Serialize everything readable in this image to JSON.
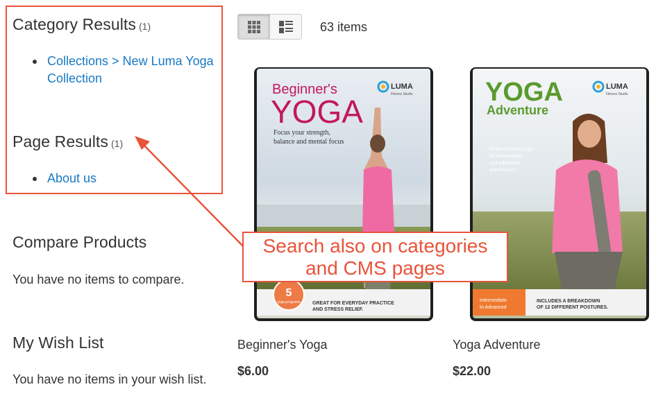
{
  "sidebar": {
    "category_results": {
      "title": "Category Results",
      "count": "(1)",
      "links": [
        "Collections > New Luma Yoga Collection"
      ]
    },
    "page_results": {
      "title": "Page Results",
      "count": "(1)",
      "links": [
        "About us"
      ]
    },
    "compare": {
      "title": "Compare Products",
      "empty_text": "You have no items to compare."
    },
    "wishlist": {
      "title": "My Wish List",
      "empty_text": "You have no items in your wish list."
    }
  },
  "toolbar": {
    "item_count": "63 items",
    "modes": [
      "grid-icon",
      "list-icon"
    ],
    "active_mode": "grid"
  },
  "products": [
    {
      "name": "Beginner's Yoga",
      "price": "$6.00",
      "cover": {
        "brand": "LUMA",
        "brand_sub": "Fitness Studio",
        "title_small": "Beginner's",
        "title_big": "YOGA",
        "subtitle": "Focus your strength, balance and mental focus",
        "badge_number": "5",
        "badge_text": "yoga programs",
        "footer_text": "GREAT FOR EVERYDAY PRACTICE AND STRESS RELIEF."
      }
    },
    {
      "name": "Yoga Adventure",
      "price": "$22.00",
      "cover": {
        "brand": "LUMA",
        "brand_sub": "Fitness Studio",
        "title_big": "YOGA",
        "title_small": "Adventure",
        "subtitle": "Power vinyasa yoga for intermediate and advanced practitioners",
        "badge_text": "Intermediate to Advanced",
        "footer_text": "INCLUDES A BREAKDOWN OF 12 DIFFERENT POSTURES."
      }
    }
  ],
  "annotation": {
    "line1": "Search also on categories",
    "line2": "and CMS pages"
  },
  "colors": {
    "annotation": "#e8533a",
    "link": "#1979c3"
  }
}
